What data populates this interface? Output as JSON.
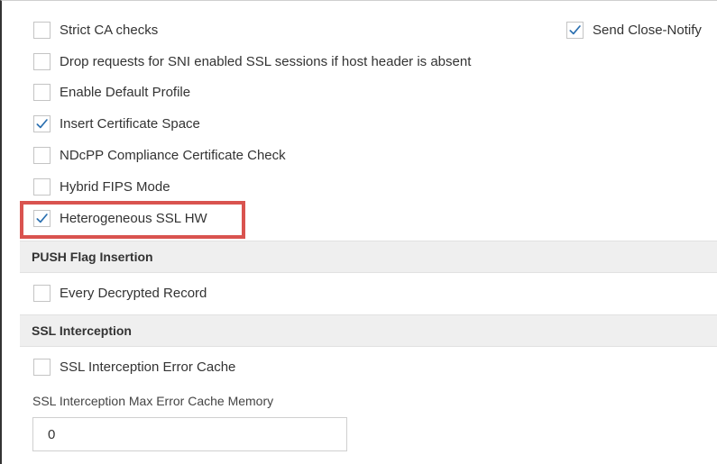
{
  "options": {
    "strict_ca_checks": {
      "label": "Strict CA checks",
      "checked": false
    },
    "send_close_notify": {
      "label": "Send Close-Notify",
      "checked": true
    },
    "drop_sni_requests": {
      "label": "Drop requests for SNI enabled SSL sessions if host header is absent",
      "checked": false
    },
    "enable_default_profile": {
      "label": "Enable Default Profile",
      "checked": false
    },
    "insert_certificate_space": {
      "label": "Insert Certificate Space",
      "checked": true
    },
    "ndcpp_compliance": {
      "label": "NDcPP Compliance Certificate Check",
      "checked": false
    },
    "hybrid_fips_mode": {
      "label": "Hybrid FIPS Mode",
      "checked": false
    },
    "heterogeneous_ssl_hw": {
      "label": "Heterogeneous SSL HW",
      "checked": true
    }
  },
  "push_flag": {
    "title": "PUSH Flag Insertion",
    "every_decrypted_record": {
      "label": "Every Decrypted Record",
      "checked": false
    }
  },
  "ssl_interception": {
    "title": "SSL Interception",
    "error_cache": {
      "label": "SSL Interception Error Cache",
      "checked": false
    },
    "max_memory_label": "SSL Interception Max Error Cache Memory",
    "max_memory_value": "0"
  },
  "colors": {
    "highlight": "#d9534f",
    "checkmark": "#2a6fb0",
    "section_bg": "#efefef"
  },
  "icons": {
    "checked": "checkmark-icon"
  }
}
